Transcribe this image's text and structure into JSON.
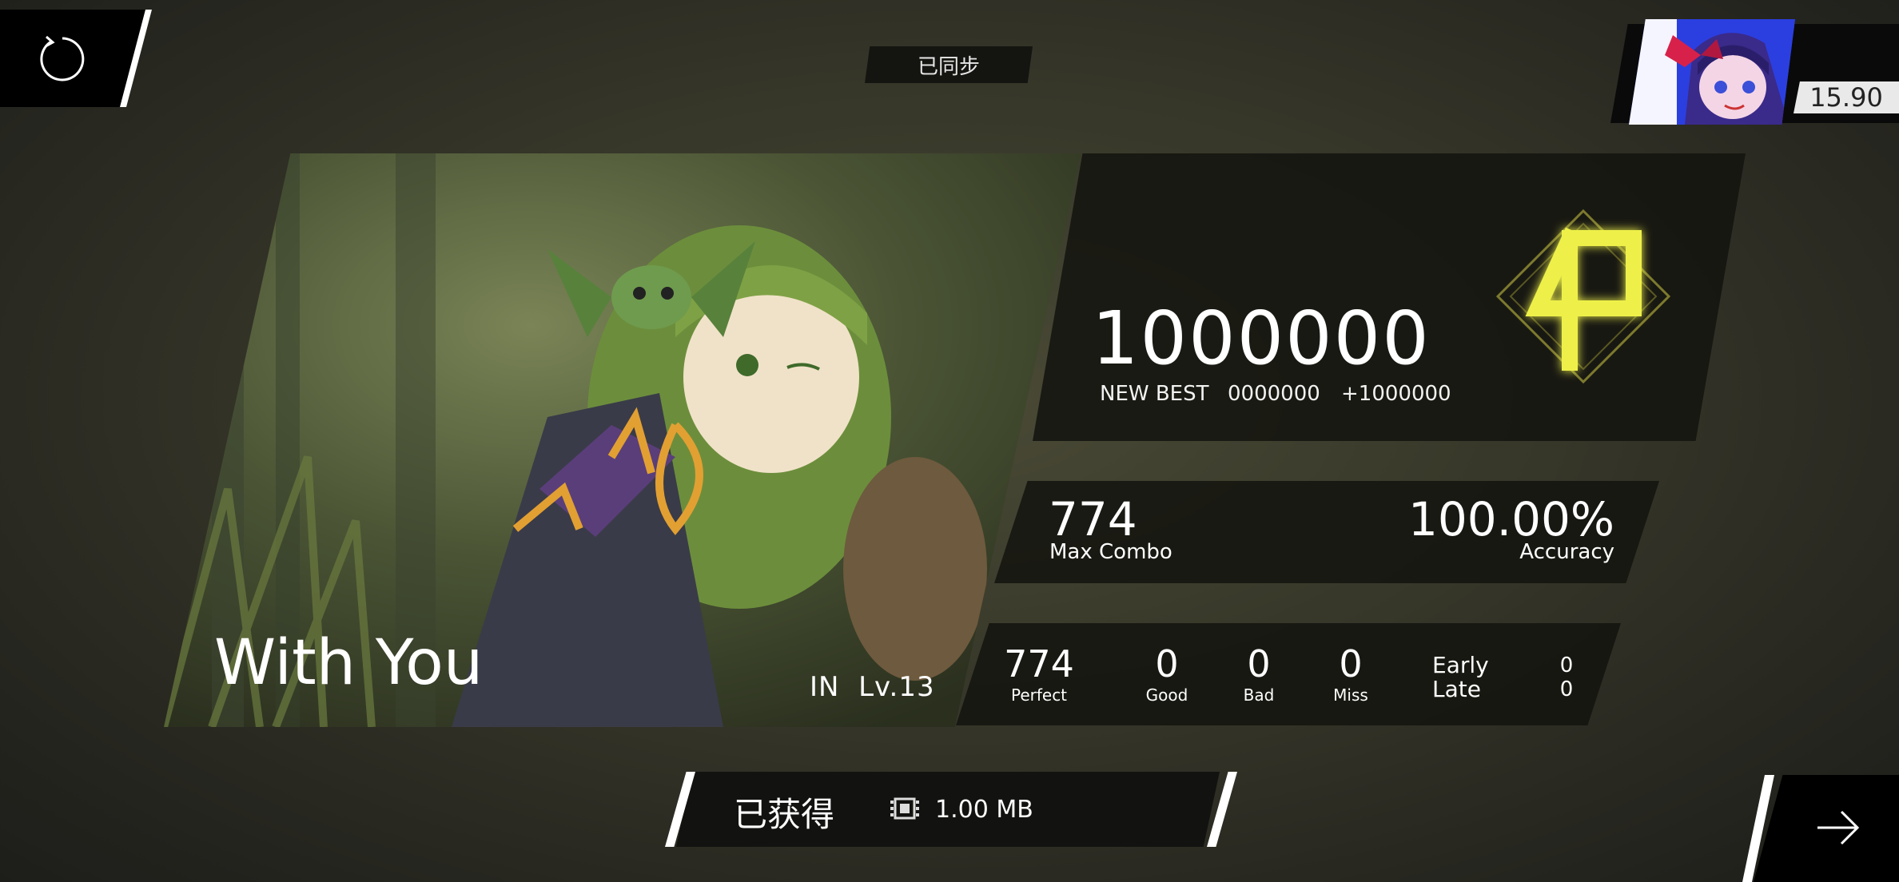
{
  "top": {
    "sync_status": "已同步",
    "rks": "15.90"
  },
  "song": {
    "title": "With You",
    "difficulty": "IN",
    "level": "Lv.13"
  },
  "result": {
    "score": "1000000",
    "new_best_label": "NEW BEST",
    "previous_best": "0000000",
    "score_diff": "+1000000",
    "rank_badge": "φ",
    "max_combo": "774",
    "max_combo_label": "Max Combo",
    "accuracy": "100.00%",
    "accuracy_label": "Accuracy",
    "perfect": "774",
    "perfect_label": "Perfect",
    "good": "0",
    "good_label": "Good",
    "bad": "0",
    "bad_label": "Bad",
    "miss": "0",
    "miss_label": "Miss",
    "early_label": "Early",
    "early": "0",
    "late_label": "Late",
    "late": "0"
  },
  "reward": {
    "title": "已获得",
    "amount": "1.00 MB"
  },
  "icons": {
    "retry": "retry-icon",
    "next": "arrow-right-icon",
    "data": "data-chip-icon"
  }
}
